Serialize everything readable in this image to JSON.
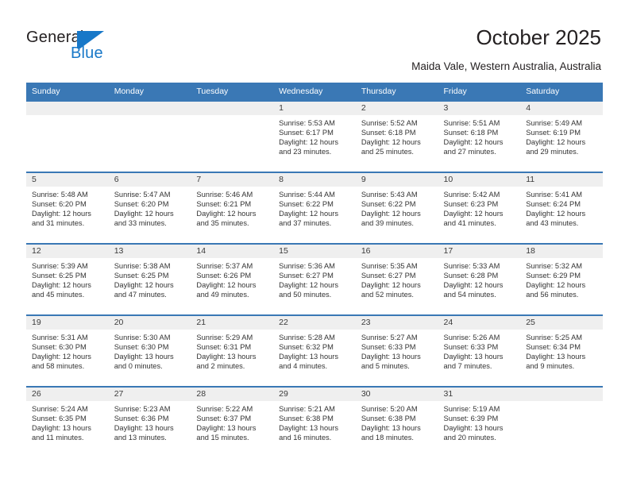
{
  "brand": {
    "word_one": "General",
    "word_two": "Blue",
    "mark": "blue-triangle-flag"
  },
  "header": {
    "title": "October 2025",
    "location": "Maida Vale, Western Australia, Australia"
  },
  "calendar": {
    "weekday_headers": [
      "Sunday",
      "Monday",
      "Tuesday",
      "Wednesday",
      "Thursday",
      "Friday",
      "Saturday"
    ],
    "colors": {
      "header_blue": "#3a78b5",
      "daynum_band": "#efefef",
      "brand_blue": "#1878c8",
      "text": "#333333"
    },
    "weeks": [
      [
        {
          "day": "",
          "empty": true
        },
        {
          "day": "",
          "empty": true
        },
        {
          "day": "",
          "empty": true
        },
        {
          "day": "1",
          "sunrise": "Sunrise: 5:53 AM",
          "sunset": "Sunset: 6:17 PM",
          "daylight": "Daylight: 12 hours and 23 minutes."
        },
        {
          "day": "2",
          "sunrise": "Sunrise: 5:52 AM",
          "sunset": "Sunset: 6:18 PM",
          "daylight": "Daylight: 12 hours and 25 minutes."
        },
        {
          "day": "3",
          "sunrise": "Sunrise: 5:51 AM",
          "sunset": "Sunset: 6:18 PM",
          "daylight": "Daylight: 12 hours and 27 minutes."
        },
        {
          "day": "4",
          "sunrise": "Sunrise: 5:49 AM",
          "sunset": "Sunset: 6:19 PM",
          "daylight": "Daylight: 12 hours and 29 minutes."
        }
      ],
      [
        {
          "day": "5",
          "sunrise": "Sunrise: 5:48 AM",
          "sunset": "Sunset: 6:20 PM",
          "daylight": "Daylight: 12 hours and 31 minutes."
        },
        {
          "day": "6",
          "sunrise": "Sunrise: 5:47 AM",
          "sunset": "Sunset: 6:20 PM",
          "daylight": "Daylight: 12 hours and 33 minutes."
        },
        {
          "day": "7",
          "sunrise": "Sunrise: 5:46 AM",
          "sunset": "Sunset: 6:21 PM",
          "daylight": "Daylight: 12 hours and 35 minutes."
        },
        {
          "day": "8",
          "sunrise": "Sunrise: 5:44 AM",
          "sunset": "Sunset: 6:22 PM",
          "daylight": "Daylight: 12 hours and 37 minutes."
        },
        {
          "day": "9",
          "sunrise": "Sunrise: 5:43 AM",
          "sunset": "Sunset: 6:22 PM",
          "daylight": "Daylight: 12 hours and 39 minutes."
        },
        {
          "day": "10",
          "sunrise": "Sunrise: 5:42 AM",
          "sunset": "Sunset: 6:23 PM",
          "daylight": "Daylight: 12 hours and 41 minutes."
        },
        {
          "day": "11",
          "sunrise": "Sunrise: 5:41 AM",
          "sunset": "Sunset: 6:24 PM",
          "daylight": "Daylight: 12 hours and 43 minutes."
        }
      ],
      [
        {
          "day": "12",
          "sunrise": "Sunrise: 5:39 AM",
          "sunset": "Sunset: 6:25 PM",
          "daylight": "Daylight: 12 hours and 45 minutes."
        },
        {
          "day": "13",
          "sunrise": "Sunrise: 5:38 AM",
          "sunset": "Sunset: 6:25 PM",
          "daylight": "Daylight: 12 hours and 47 minutes."
        },
        {
          "day": "14",
          "sunrise": "Sunrise: 5:37 AM",
          "sunset": "Sunset: 6:26 PM",
          "daylight": "Daylight: 12 hours and 49 minutes."
        },
        {
          "day": "15",
          "sunrise": "Sunrise: 5:36 AM",
          "sunset": "Sunset: 6:27 PM",
          "daylight": "Daylight: 12 hours and 50 minutes."
        },
        {
          "day": "16",
          "sunrise": "Sunrise: 5:35 AM",
          "sunset": "Sunset: 6:27 PM",
          "daylight": "Daylight: 12 hours and 52 minutes."
        },
        {
          "day": "17",
          "sunrise": "Sunrise: 5:33 AM",
          "sunset": "Sunset: 6:28 PM",
          "daylight": "Daylight: 12 hours and 54 minutes."
        },
        {
          "day": "18",
          "sunrise": "Sunrise: 5:32 AM",
          "sunset": "Sunset: 6:29 PM",
          "daylight": "Daylight: 12 hours and 56 minutes."
        }
      ],
      [
        {
          "day": "19",
          "sunrise": "Sunrise: 5:31 AM",
          "sunset": "Sunset: 6:30 PM",
          "daylight": "Daylight: 12 hours and 58 minutes."
        },
        {
          "day": "20",
          "sunrise": "Sunrise: 5:30 AM",
          "sunset": "Sunset: 6:30 PM",
          "daylight": "Daylight: 13 hours and 0 minutes."
        },
        {
          "day": "21",
          "sunrise": "Sunrise: 5:29 AM",
          "sunset": "Sunset: 6:31 PM",
          "daylight": "Daylight: 13 hours and 2 minutes."
        },
        {
          "day": "22",
          "sunrise": "Sunrise: 5:28 AM",
          "sunset": "Sunset: 6:32 PM",
          "daylight": "Daylight: 13 hours and 4 minutes."
        },
        {
          "day": "23",
          "sunrise": "Sunrise: 5:27 AM",
          "sunset": "Sunset: 6:33 PM",
          "daylight": "Daylight: 13 hours and 5 minutes."
        },
        {
          "day": "24",
          "sunrise": "Sunrise: 5:26 AM",
          "sunset": "Sunset: 6:33 PM",
          "daylight": "Daylight: 13 hours and 7 minutes."
        },
        {
          "day": "25",
          "sunrise": "Sunrise: 5:25 AM",
          "sunset": "Sunset: 6:34 PM",
          "daylight": "Daylight: 13 hours and 9 minutes."
        }
      ],
      [
        {
          "day": "26",
          "sunrise": "Sunrise: 5:24 AM",
          "sunset": "Sunset: 6:35 PM",
          "daylight": "Daylight: 13 hours and 11 minutes."
        },
        {
          "day": "27",
          "sunrise": "Sunrise: 5:23 AM",
          "sunset": "Sunset: 6:36 PM",
          "daylight": "Daylight: 13 hours and 13 minutes."
        },
        {
          "day": "28",
          "sunrise": "Sunrise: 5:22 AM",
          "sunset": "Sunset: 6:37 PM",
          "daylight": "Daylight: 13 hours and 15 minutes."
        },
        {
          "day": "29",
          "sunrise": "Sunrise: 5:21 AM",
          "sunset": "Sunset: 6:38 PM",
          "daylight": "Daylight: 13 hours and 16 minutes."
        },
        {
          "day": "30",
          "sunrise": "Sunrise: 5:20 AM",
          "sunset": "Sunset: 6:38 PM",
          "daylight": "Daylight: 13 hours and 18 minutes."
        },
        {
          "day": "31",
          "sunrise": "Sunrise: 5:19 AM",
          "sunset": "Sunset: 6:39 PM",
          "daylight": "Daylight: 13 hours and 20 minutes."
        },
        {
          "day": "",
          "empty": true
        }
      ]
    ]
  }
}
